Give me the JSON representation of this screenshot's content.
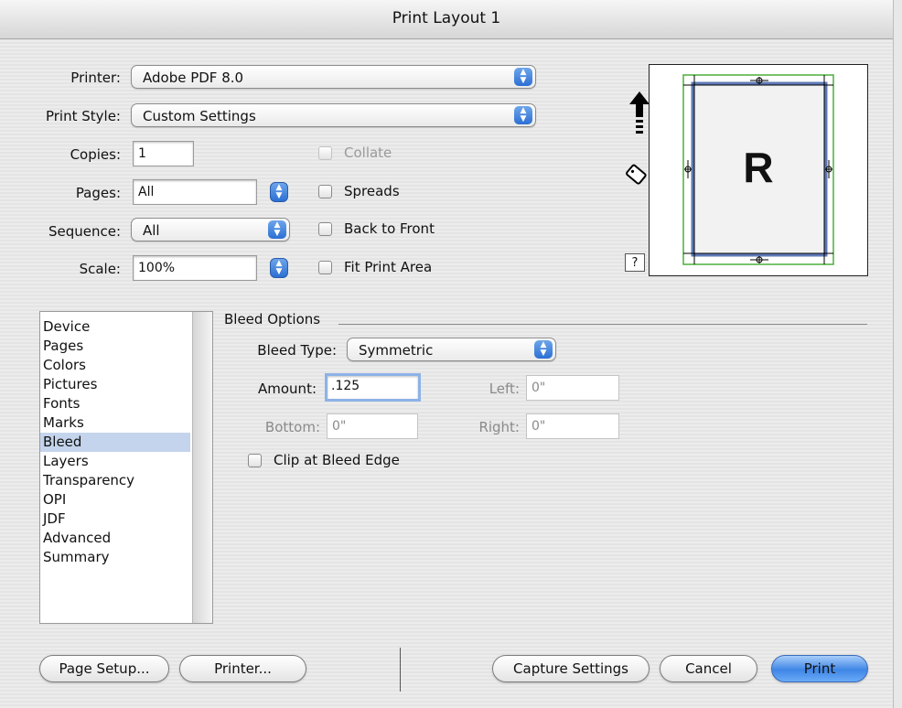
{
  "window": {
    "title": "Print Layout 1"
  },
  "top": {
    "printer": {
      "label": "Printer:",
      "value": "Adobe PDF 8.0"
    },
    "print_style": {
      "label": "Print Style:",
      "value": "Custom Settings"
    },
    "copies": {
      "label": "Copies:",
      "value": "1"
    },
    "pages": {
      "label": "Pages:",
      "value": "All"
    },
    "sequence": {
      "label": "Sequence:",
      "value": "All"
    },
    "scale": {
      "label": "Scale:",
      "value": "100%"
    },
    "checkboxes": {
      "collate": {
        "label": "Collate",
        "checked": false,
        "enabled": false
      },
      "spreads": {
        "label": "Spreads",
        "checked": false
      },
      "back_to_front": {
        "label": "Back to Front",
        "checked": false
      },
      "fit_print_area": {
        "label": "Fit Print Area",
        "checked": false
      }
    }
  },
  "preview": {
    "page_letter": "R",
    "help_label": "?",
    "icons": [
      "up-arrow-icon",
      "tag-icon"
    ]
  },
  "sidebar": {
    "items": [
      "Device",
      "Pages",
      "Colors",
      "Pictures",
      "Fonts",
      "Marks",
      "Bleed",
      "Layers",
      "Transparency",
      "OPI",
      "JDF",
      "Advanced",
      "Summary"
    ],
    "selected": "Bleed"
  },
  "bleed": {
    "section_title": "Bleed Options",
    "bleed_type": {
      "label": "Bleed Type:",
      "value": "Symmetric"
    },
    "amount": {
      "label": "Amount:",
      "value": ".125"
    },
    "left": {
      "label": "Left:",
      "value": "0\""
    },
    "bottom": {
      "label": "Bottom:",
      "value": "0\""
    },
    "right": {
      "label": "Right:",
      "value": "0\""
    },
    "clip": {
      "label": "Clip at Bleed Edge",
      "checked": false
    }
  },
  "buttons": {
    "page_setup": "Page Setup...",
    "printer": "Printer...",
    "capture_settings": "Capture Settings",
    "cancel": "Cancel",
    "print": "Print"
  },
  "colors": {
    "accent": "#3f86e6",
    "selection": "#c4d4ec",
    "bleed_guide": "#4caf3a"
  }
}
